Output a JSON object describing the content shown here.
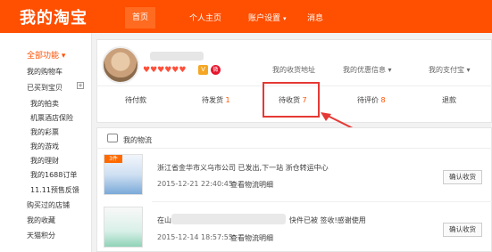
{
  "header": {
    "logo": "我的淘宝",
    "nav": [
      {
        "label": "首页",
        "active": true
      },
      {
        "label": "个人主页"
      },
      {
        "label": "账户设置"
      },
      {
        "label": "消息"
      }
    ]
  },
  "sidebar": {
    "items": [
      {
        "label": "全部功能"
      },
      {
        "label": "我的购物车"
      },
      {
        "label": "已买到宝贝"
      },
      {
        "label": "我的拍卖"
      },
      {
        "label": "机票酒店保险"
      },
      {
        "label": "我的彩票"
      },
      {
        "label": "我的游戏"
      },
      {
        "label": "我的理财"
      },
      {
        "label": "我的1688订单"
      },
      {
        "label": "11.11预售反馈"
      },
      {
        "label": "购买过的店铺"
      },
      {
        "label": "我的收藏"
      },
      {
        "label": "天猫积分"
      }
    ],
    "expand_symbol": "+"
  },
  "profile": {
    "hearts": "♥♥♥♥♥♥",
    "badge_v": "V",
    "badge_weibo": "微",
    "address_link": "我的收货地址",
    "coupon_link": "我的优惠信息 ▾",
    "wallet_link": "我的支付宝 ▾"
  },
  "order_status": [
    {
      "label": "待付款",
      "count": ""
    },
    {
      "label": "待发货",
      "count": "1"
    },
    {
      "label": "待收货",
      "count": "7"
    },
    {
      "label": "待评价",
      "count": "8"
    },
    {
      "label": "退款",
      "count": ""
    }
  ],
  "logistics": {
    "title": "我的物流",
    "rows": [
      {
        "tag": "3件",
        "text": "浙江省金华市义乌市公司 已发出,下一站 浙仓转运中心",
        "date": "2015-12-21 22:40:45",
        "link": "查看物流明细",
        "button": "确认收货"
      },
      {
        "text_prefix": "在山",
        "text_suffix": "快件已被 签收!感谢使用",
        "date": "2015-12-14 18:57:55",
        "link": "查看物流明细",
        "button": "确认收货"
      }
    ]
  },
  "colors": {
    "brand": "#ff4f00",
    "highlight": "#e53935"
  }
}
